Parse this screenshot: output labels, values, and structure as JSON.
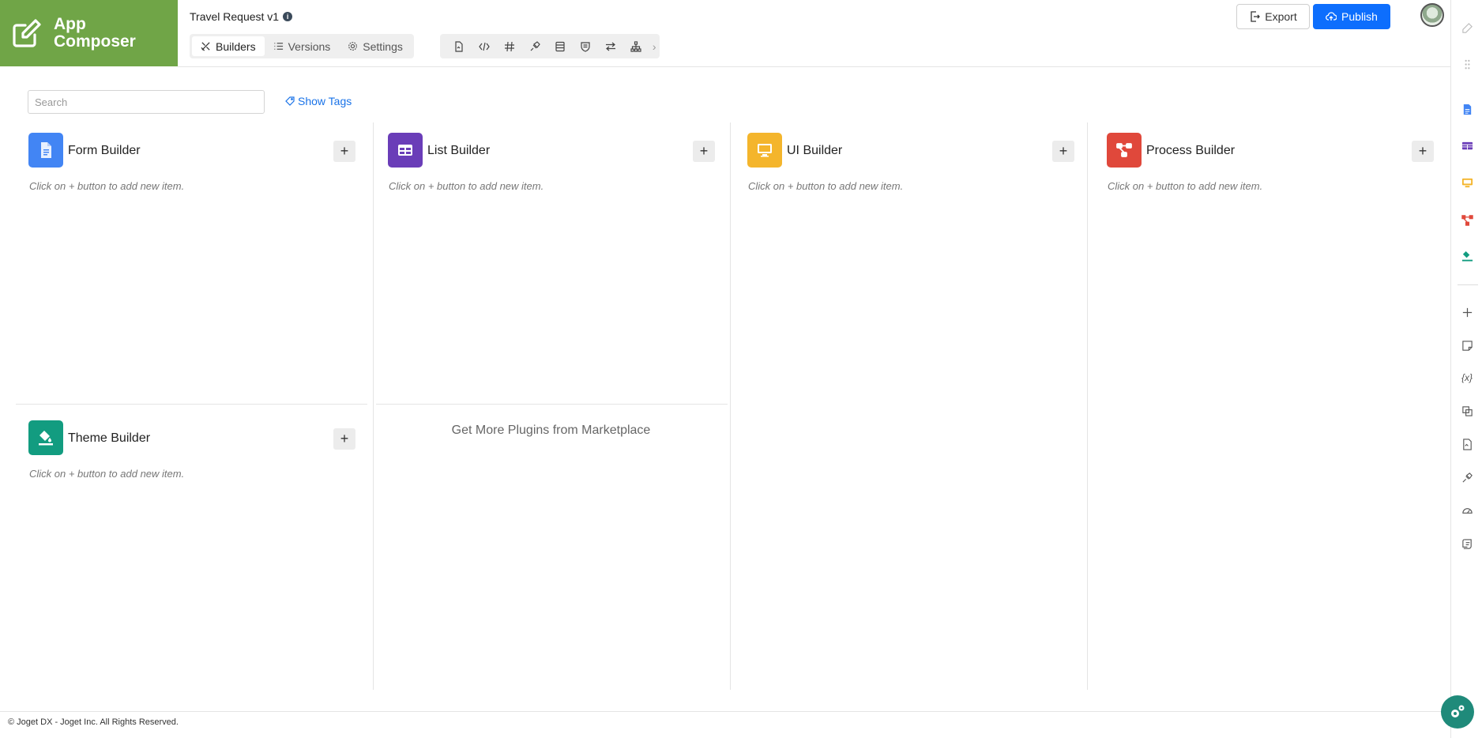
{
  "logo": {
    "text": "App Composer",
    "color": "#70a547"
  },
  "app": {
    "title": "Travel Request v1",
    "info_icon": "info-icon"
  },
  "tabs": [
    {
      "label": "Builders",
      "icon": "builders-icon",
      "active": true
    },
    {
      "label": "Versions",
      "icon": "list-icon",
      "active": false
    },
    {
      "label": "Settings",
      "icon": "gear-icon",
      "active": false
    }
  ],
  "toolbar": {
    "icons": [
      "document-icon",
      "code-icon",
      "hash-icon",
      "plugin-icon",
      "database-icon",
      "shield-icon",
      "arrows-icon",
      "sitemap-icon"
    ],
    "more": "›"
  },
  "actions": {
    "export_label": "Export",
    "publish_label": "Publish",
    "publish_color": "#0d6efd"
  },
  "search": {
    "placeholder": "Search",
    "value": ""
  },
  "show_tags": {
    "label": "Show Tags"
  },
  "builders": [
    {
      "name": "Form Builder",
      "hint": "Click on + button to add new item.",
      "color": "#4285f4",
      "icon": "form-icon",
      "add_label": "+"
    },
    {
      "name": "List Builder",
      "hint": "Click on + button to add new item.",
      "color": "#6a3db8",
      "icon": "list-grid-icon",
      "add_label": "+"
    },
    {
      "name": "UI Builder",
      "hint": "Click on + button to add new item.",
      "color": "#f4b52c",
      "icon": "monitor-icon",
      "add_label": "+"
    },
    {
      "name": "Process Builder",
      "hint": "Click on + button to add new item.",
      "color": "#e0483b",
      "icon": "process-icon",
      "add_label": "+"
    },
    {
      "name": "Theme Builder",
      "hint": "Click on + button to add new item.",
      "color": "#129c80",
      "icon": "paint-bucket-icon",
      "add_label": "+"
    }
  ],
  "marketplace": {
    "label": "Get More Plugins from Marketplace"
  },
  "footer": {
    "text": "© Joget DX - Joget Inc. All Rights Reserved."
  },
  "rail": {
    "items": [
      "edit-icon",
      "drag-icon",
      "form-icon",
      "list-grid-icon",
      "monitor-icon",
      "process-icon",
      "paint-bucket-icon",
      "plus-icon",
      "note-icon",
      "variable-icon",
      "copy-icon",
      "pdf-icon",
      "plugin-icon",
      "gauge-icon",
      "script-icon"
    ],
    "variable_text": "{x}"
  },
  "fab": {
    "icon": "settings-gears-icon",
    "color": "#1f8a7a"
  }
}
